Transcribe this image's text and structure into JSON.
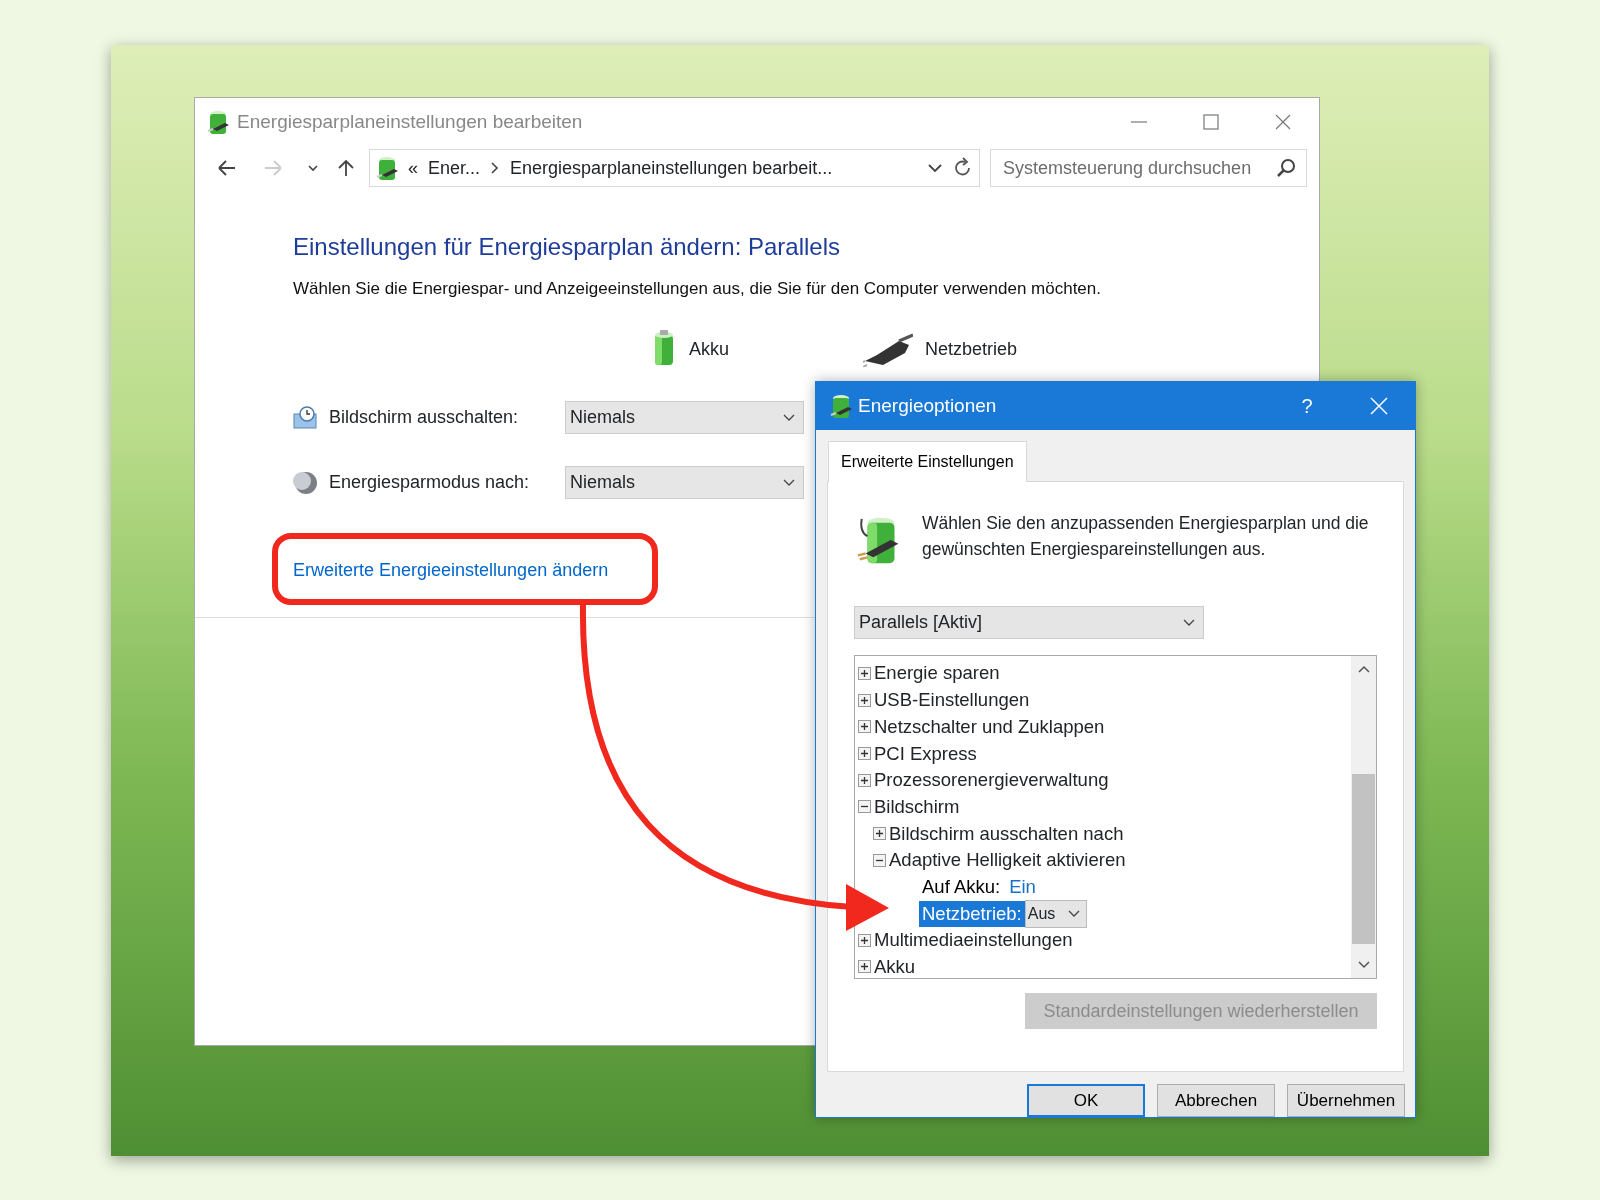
{
  "window": {
    "title": "Energiesparplaneinstellungen bearbeiten",
    "nav": {
      "back_disabled": false,
      "forward_disabled": true,
      "breadcrumb_prefix": "«",
      "breadcrumbs": [
        "Ener...",
        "Energiesparplaneinstellungen bearbeit..."
      ]
    },
    "search": {
      "placeholder": "Systemsteuerung durchsuchen"
    },
    "heading": "Einstellungen für Energiesparplan ändern: Parallels",
    "description": "Wählen Sie die Energiespar- und Anzeigeeinstellungen aus, die Sie für den Computer verwenden möchten.",
    "columns": [
      {
        "kind": "battery",
        "label": "Akku"
      },
      {
        "kind": "plug",
        "label": "Netzbetrieb"
      }
    ],
    "settings": [
      {
        "kind": "display",
        "label": "Bildschirm ausschalten:",
        "value": "Niemals"
      },
      {
        "kind": "sleep",
        "label": "Energiesparmodus nach:",
        "value": "Niemals"
      }
    ],
    "advanced_link": "Erweiterte Energieeinstellungen ändern"
  },
  "dialog": {
    "title": "Energieoptionen",
    "help": "?",
    "tabs": [
      {
        "label": "Erweiterte Einstellungen",
        "selected": true
      }
    ],
    "intro": "Wählen Sie den anzupassenden Energiesparplan und die gewünschten Energiespareinstellungen aus.",
    "plan": "Parallels [Aktiv]",
    "tree": [
      {
        "kind": "group",
        "label": "Energie sparen",
        "expanded": false
      },
      {
        "kind": "group",
        "label": "USB-Einstellungen",
        "expanded": false
      },
      {
        "kind": "group",
        "label": "Netzschalter und Zuklappen",
        "expanded": false
      },
      {
        "kind": "group",
        "label": "PCI Express",
        "expanded": false
      },
      {
        "kind": "group",
        "label": "Prozessorenergieverwaltung",
        "expanded": false
      },
      {
        "kind": "group",
        "label": "Bildschirm",
        "expanded": true,
        "children": [
          {
            "kind": "group",
            "label": "Bildschirm ausschalten nach",
            "expanded": false
          },
          {
            "kind": "group",
            "label": "Adaptive Helligkeit aktivieren",
            "expanded": true,
            "children": [
              {
                "kind": "value",
                "label": "Auf Akku:",
                "value": "Ein",
                "selected": false
              },
              {
                "kind": "dropdown",
                "label": "Netzbetrieb:",
                "value": "Aus",
                "selected": true
              }
            ]
          }
        ]
      },
      {
        "kind": "group",
        "label": "Multimediaeinstellungen",
        "expanded": false
      },
      {
        "kind": "group",
        "label": "Akku",
        "expanded": false
      }
    ],
    "restore_button": {
      "label": "Standardeinstellungen wiederherstellen",
      "disabled": true
    },
    "buttons": [
      {
        "label": "OK",
        "default": true
      },
      {
        "label": "Abbrechen",
        "default": false
      },
      {
        "label": "Übernehmen",
        "default": false
      }
    ]
  }
}
